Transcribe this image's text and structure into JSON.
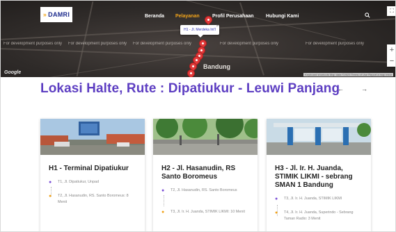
{
  "nav": {
    "logo_text": "DAMRI",
    "items": [
      {
        "label": "Beranda",
        "active": false
      },
      {
        "label": "Pelayanan",
        "active": true
      },
      {
        "label": "Profil Perusahaan",
        "active": false
      },
      {
        "label": "Hubungi Kami",
        "active": false
      }
    ],
    "search_icon": "search-icon"
  },
  "map": {
    "dev_watermark": "For development purposes only",
    "popup_label": "H1 - Jl. Merdeka Int'l",
    "city_label": "Bandung",
    "google_label": "Google",
    "footer_text": "Keyboard shortcuts   Map data ©2023   Terms of Use   Report a map error",
    "zoom_in": "+",
    "zoom_out": "−",
    "fullscreen_icon": "⛶"
  },
  "page": {
    "title": "Lokasi Halte, Rute : Dipatiukur - Leuwi Panjang",
    "prev_arrow": "←",
    "next_arrow": "→"
  },
  "colors": {
    "title": "#5d3ec2",
    "nav_active": "#f3a51b",
    "marker": "#e23b3b"
  },
  "cards": [
    {
      "name": "H1 - Terminal Dipatiukur",
      "stops": [
        {
          "text": "T1, Jl. Dipatiukur, Unpad",
          "pin": "purple"
        },
        {
          "text": "T2, Jl. Hasanudin, RS. Santo Boromeus: 8 Menit",
          "pin": "orange"
        }
      ]
    },
    {
      "name": "H2 - Jl. Hasanudin, RS Santo Boromeus",
      "stops": [
        {
          "text": "T2, Jl. Hasanudin, RS. Santo Boromeus",
          "pin": "purple"
        },
        {
          "text": "T3, Jl. Ir. H. Juanda, STIMIK LIKMI: 10 Menit",
          "pin": "orange"
        }
      ]
    },
    {
      "name": "H3 - Jl. Ir. H. Juanda, STIMIK LIKMI - sebrang SMAN 1 Bandung",
      "stops": [
        {
          "text": "T3, Jl. Ir. H. Juanda, STIMIK LIKMI",
          "pin": "purple"
        },
        {
          "text": "T4, Jl. Ir. H. Juanda, Superindo - Sebrang Taman Radio: 3 Menit",
          "pin": "orange"
        }
      ]
    }
  ]
}
